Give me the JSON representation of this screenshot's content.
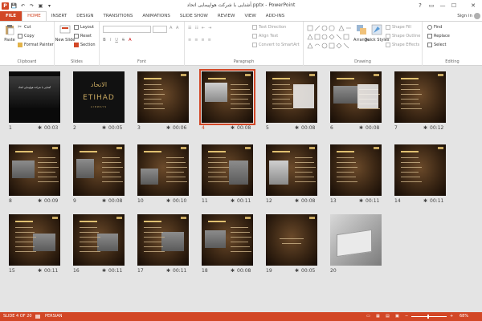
{
  "window": {
    "title": "آشنایی با شرکت هواپیمایی اتحاد.pptx - PowerPoint",
    "controls": [
      "?",
      "▭",
      "—",
      "☐",
      "✕"
    ]
  },
  "qat": {
    "app": "P",
    "save": "💾",
    "undo": "↶",
    "redo": "↷",
    "start": "▣",
    "more": "▾"
  },
  "tabs": [
    "FILE",
    "HOME",
    "INSERT",
    "DESIGN",
    "TRANSITIONS",
    "ANIMATIONS",
    "SLIDE SHOW",
    "REVIEW",
    "VIEW",
    "ADD-INS"
  ],
  "signin": "Sign in",
  "ribbon": {
    "clipboard": {
      "label": "Clipboard",
      "paste": "Paste",
      "cut": "Cut",
      "copy": "Copy",
      "format_painter": "Format Painter"
    },
    "slides": {
      "label": "Slides",
      "new_slide": "New Slide",
      "layout": "Layout",
      "reset": "Reset",
      "section": "Section"
    },
    "font": {
      "label": "Font"
    },
    "paragraph": {
      "label": "Paragraph",
      "text_direction": "Text Direction",
      "align_text": "Align Text",
      "convert_smartart": "Convert to SmartArt"
    },
    "drawing": {
      "label": "Drawing",
      "arrange": "Arrange",
      "quick_styles": "Quick Styles",
      "shape_fill": "Shape Fill",
      "shape_outline": "Shape Outline",
      "shape_effects": "Shape Effects"
    },
    "editing": {
      "label": "Editing",
      "find": "Find",
      "replace": "Replace",
      "select": "Select"
    }
  },
  "slides": [
    {
      "num": "1",
      "time": "00:03"
    },
    {
      "num": "2",
      "time": "00:05"
    },
    {
      "num": "3",
      "time": "00:06"
    },
    {
      "num": "4",
      "time": "00:08"
    },
    {
      "num": "5",
      "time": "00:08"
    },
    {
      "num": "6",
      "time": "00:08"
    },
    {
      "num": "7",
      "time": "00:12"
    },
    {
      "num": "8",
      "time": "00:09"
    },
    {
      "num": "9",
      "time": "00:08"
    },
    {
      "num": "10",
      "time": "00:10"
    },
    {
      "num": "11",
      "time": "00:11"
    },
    {
      "num": "12",
      "time": "00:08"
    },
    {
      "num": "13",
      "time": "00:11"
    },
    {
      "num": "14",
      "time": "00:11"
    },
    {
      "num": "15",
      "time": "00:11"
    },
    {
      "num": "16",
      "time": "00:11"
    },
    {
      "num": "17",
      "time": "00:11"
    },
    {
      "num": "18",
      "time": "00:08"
    },
    {
      "num": "19",
      "time": "00:05"
    },
    {
      "num": "20",
      "time": ""
    }
  ],
  "time_marker": "✱",
  "thumb_text": {
    "slide1": "آشنایی با شرکت هواپیمایی اتحاد",
    "slide2_arabic": "الاتحاد",
    "slide2_brand": "ETIHAD",
    "slide2_sub": "AIRWAYS"
  },
  "status": {
    "slide": "SLIDE 4 OF 20",
    "language": "PERSIAN",
    "zoom": "68%"
  },
  "colors": {
    "accent": "#d24726"
  }
}
